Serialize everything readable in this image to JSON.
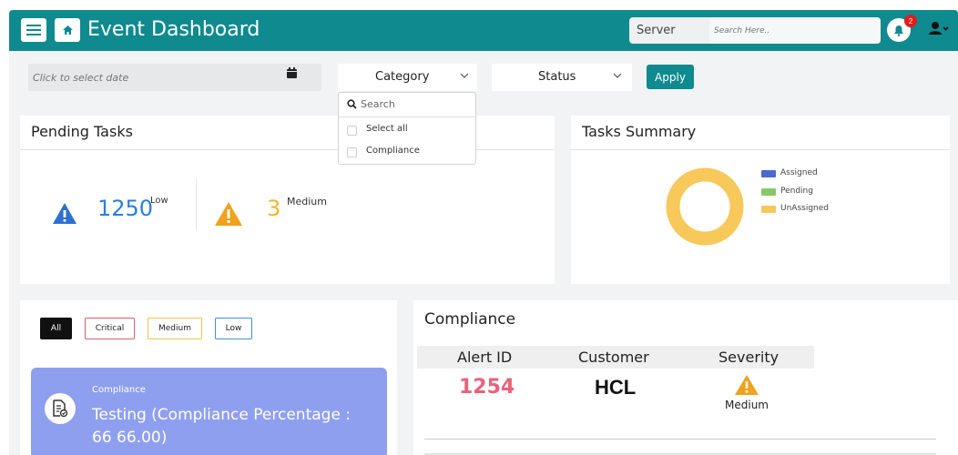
{
  "header": {
    "title": "Event Dashboard",
    "server_label": "Server",
    "search_placeholder": "Search Here..",
    "notification_count": "2"
  },
  "filters_bar": {
    "date_placeholder": "Click to select date",
    "category_label": "Category",
    "status_label": "Status",
    "apply_label": "Apply"
  },
  "category_dropdown": {
    "search_placeholder": "Search",
    "options": [
      "Select all",
      "Compliance"
    ]
  },
  "pending_tasks": {
    "title": "Pending Tasks",
    "low_value": "1250",
    "low_label": "Low",
    "medium_value": "3",
    "medium_label": "Medium"
  },
  "tasks_summary": {
    "title": "Tasks Summary",
    "legend": [
      {
        "label": "Assigned",
        "color": "#4a6ad0"
      },
      {
        "label": "Pending",
        "color": "#86c96a"
      },
      {
        "label": "UnAssigned",
        "color": "#f7c85a"
      }
    ],
    "chart_data": {
      "type": "pie",
      "categories": [
        "Assigned",
        "Pending",
        "UnAssigned"
      ],
      "values": [
        0,
        0,
        100
      ]
    }
  },
  "severity_filters": {
    "all": "All",
    "critical": "Critical",
    "medium": "Medium",
    "low": "Low"
  },
  "tile": {
    "category": "Compliance",
    "title": "Testing (Compliance Percentage : 66 66.00)"
  },
  "compliance": {
    "title": "Compliance",
    "headers": [
      "Alert ID",
      "Customer",
      "Severity"
    ],
    "row": {
      "alert_id": "1254",
      "customer": "HCL",
      "severity": "Medium"
    }
  },
  "colors": {
    "header_bg": "#0f8a8f",
    "low": "#2a7de1",
    "medium": "#f5b626",
    "alert_id": "#e8637a",
    "tile_bg": "#8f9ff0"
  }
}
